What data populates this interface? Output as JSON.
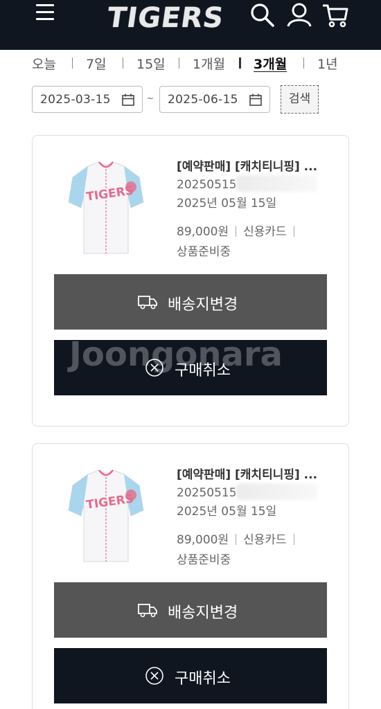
{
  "header": {
    "logo": "TIGERS",
    "icons": [
      "menu-icon",
      "search-icon",
      "user-icon",
      "cart-icon"
    ],
    "background": "#0f1620"
  },
  "period_tabs": [
    {
      "label": "오늘",
      "active": false
    },
    {
      "label": "7일",
      "active": false
    },
    {
      "label": "15일",
      "active": false
    },
    {
      "label": "1개월",
      "active": false
    },
    {
      "label": "3개월",
      "active": true
    },
    {
      "label": "1년",
      "active": false
    }
  ],
  "date_range": {
    "start": "2025-03-15",
    "end": "2025-06-15",
    "separator": "~",
    "search_label": "검색"
  },
  "orders": [
    {
      "product_name": "[예약판매] [캐치티니핑] ...",
      "order_no": "20250515",
      "order_date": "2025년 05월 15일",
      "price": "89,000원",
      "payment": "신용카드",
      "status": "상품준비중",
      "ship_change_label": "배송지변경",
      "cancel_label": "구매취소"
    },
    {
      "product_name": "[예약판매] [캐치티니핑] ...",
      "order_no": "20250515",
      "order_date": "2025년 05월 15일",
      "price": "89,000원",
      "payment": "신용카드",
      "status": "상품준비중",
      "ship_change_label": "배송지변경",
      "cancel_label": "구매취소"
    }
  ],
  "jersey_logo_text": "TIGERS",
  "watermark": "Joongonara",
  "colors": {
    "dark_navy": "#0f1620",
    "gray_button": "#555555",
    "jersey_sleeve": "#a9d6ec",
    "jersey_logo": "#e86a8a"
  }
}
